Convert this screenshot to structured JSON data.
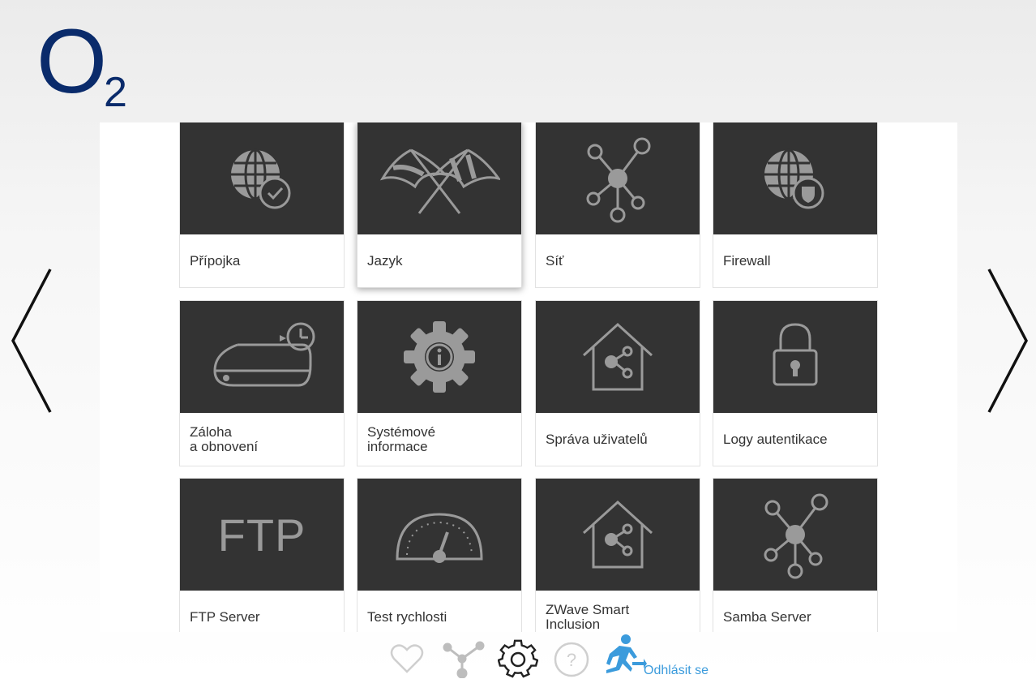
{
  "brand": {
    "logo_main": "O",
    "logo_sub": "2",
    "color": "#0a2b6b"
  },
  "tiles": [
    {
      "label": "Přípojka",
      "icon": "globe-check-icon"
    },
    {
      "label": "Jazyk",
      "icon": "flags-icon"
    },
    {
      "label": "Síť",
      "icon": "network-icon"
    },
    {
      "label": "Firewall",
      "icon": "globe-shield-icon"
    },
    {
      "label": "Záloha\na obnovení",
      "icon": "backup-restore-icon"
    },
    {
      "label": "Systémové\ninformace",
      "icon": "gear-info-icon"
    },
    {
      "label": "Správa uživatelů",
      "icon": "house-users-icon"
    },
    {
      "label": "Logy autentikace",
      "icon": "padlock-icon"
    },
    {
      "label": "FTP Server",
      "icon_text": "FTP"
    },
    {
      "label": "Test rychlosti",
      "icon": "speedometer-icon"
    },
    {
      "label": "ZWave Smart\nInclusion",
      "icon": "house-zwave-icon"
    },
    {
      "label": "Samba Server",
      "icon": "samba-network-icon"
    }
  ],
  "active_tile": "Jazyk",
  "navigation": {
    "prev": "chevron-left-icon",
    "next": "chevron-right-icon"
  },
  "bottom_bar": {
    "items": [
      "heart-icon",
      "topology-icon",
      "settings-gear-icon",
      "help-icon",
      "logout-runner-icon"
    ],
    "logout_label": "Odhlásit se",
    "accent": "#3b9bdc"
  }
}
